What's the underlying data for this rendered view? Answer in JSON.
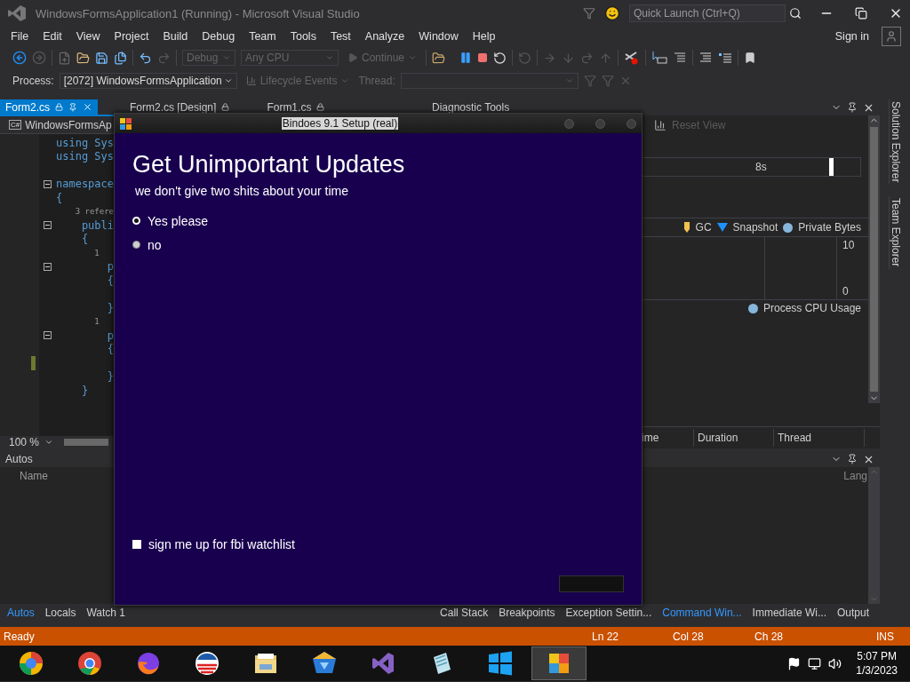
{
  "window": {
    "title": "WindowsFormsApplication1 (Running) - Microsoft Visual Studio"
  },
  "quick_launch": {
    "placeholder": "Quick Launch (Ctrl+Q)"
  },
  "menu": [
    "File",
    "Edit",
    "View",
    "Project",
    "Build",
    "Debug",
    "Team",
    "Tools",
    "Test",
    "Analyze",
    "Window",
    "Help"
  ],
  "account": {
    "label": "Sign in"
  },
  "toolbar": {
    "configuration": "Debug",
    "platform": "Any CPU",
    "continue": "Continue"
  },
  "debug_location": {
    "process_label": "Process:",
    "process": "[2072] WindowsFormsApplication",
    "lifecycle": "Lifecycle Events",
    "thread_label": "Thread:"
  },
  "editor": {
    "tabs": [
      {
        "label": "Form2.cs",
        "selected": true
      },
      {
        "label": "Form2.cs [Design]",
        "selected": false
      },
      {
        "label": "Form1.cs",
        "selected": false
      }
    ],
    "file_badge": "C#",
    "navigation": "WindowsFormsAp",
    "lines": [
      {
        "kind": "code",
        "text": "using Sys",
        "fold": false,
        "modified": false
      },
      {
        "kind": "code",
        "text": "using Sys",
        "fold": false,
        "modified": false
      },
      {
        "kind": "blank",
        "fold": false,
        "modified": false
      },
      {
        "kind": "code",
        "text": "namespace",
        "fold": true,
        "modified": false
      },
      {
        "kind": "code",
        "text": "{",
        "fold": false,
        "modified": false
      },
      {
        "kind": "lens",
        "text": "    3 refere",
        "fold": false,
        "modified": false
      },
      {
        "kind": "code",
        "text": "    publi",
        "fold": true,
        "modified": false
      },
      {
        "kind": "code",
        "text": "    {",
        "fold": false,
        "modified": false
      },
      {
        "kind": "lens",
        "text": "        1",
        "fold": false,
        "modified": false
      },
      {
        "kind": "code",
        "text": "        p",
        "fold": true,
        "modified": false
      },
      {
        "kind": "code",
        "text": "        {",
        "fold": false,
        "modified": false
      },
      {
        "kind": "blank",
        "fold": false,
        "modified": false
      },
      {
        "kind": "code",
        "text": "        }",
        "fold": false,
        "modified": false
      },
      {
        "kind": "lens",
        "text": "        1",
        "fold": false,
        "modified": false
      },
      {
        "kind": "code",
        "text": "        p",
        "fold": true,
        "modified": false
      },
      {
        "kind": "code",
        "text": "        {",
        "fold": false,
        "modified": false
      },
      {
        "kind": "blank",
        "fold": false,
        "modified": true
      },
      {
        "kind": "code",
        "text": "        }",
        "fold": false,
        "modified": false
      },
      {
        "kind": "code",
        "text": "    }",
        "fold": false,
        "modified": false
      }
    ],
    "zoom": "100 %"
  },
  "diagnostic_tools": {
    "title": "Diagnostic Tools",
    "reset_view": "Reset View",
    "ruler_label": "8s",
    "legend": [
      {
        "kind": "gc",
        "label": "GC"
      },
      {
        "kind": "snapshot",
        "label": "Snapshot"
      },
      {
        "kind": "series",
        "label": "Private Bytes"
      }
    ],
    "axis_max": "10",
    "axis_min": "0",
    "cpu_legend": "Process CPU Usage",
    "columns": [
      "ime",
      "Duration",
      "Thread"
    ]
  },
  "side_tabs": [
    "Solution Explorer",
    "Team Explorer"
  ],
  "autos": {
    "title": "Autos",
    "columns": [
      "Name"
    ]
  },
  "output_panel": {
    "columns": [
      "Lang"
    ]
  },
  "bottom_tabs_left": [
    {
      "label": "Autos",
      "selected": true
    },
    {
      "label": "Locals",
      "selected": false
    },
    {
      "label": "Watch 1",
      "selected": false
    }
  ],
  "bottom_tabs_right": [
    {
      "label": "Call Stack",
      "selected": false
    },
    {
      "label": "Breakpoints",
      "selected": false
    },
    {
      "label": "Exception Settin...",
      "selected": false
    },
    {
      "label": "Command Win...",
      "selected": true
    },
    {
      "label": "Immediate Wi...",
      "selected": false
    },
    {
      "label": "Output",
      "selected": false
    }
  ],
  "status_bar": {
    "state": "Ready",
    "line": "Ln 22",
    "column": "Col 28",
    "char": "Ch 28",
    "mode": "INS"
  },
  "taskbar": {
    "apps": [
      {
        "kind": "ball",
        "selected": false
      },
      {
        "kind": "chrome",
        "selected": false
      },
      {
        "kind": "fox",
        "selected": false
      },
      {
        "kind": "logo",
        "selected": false
      },
      {
        "kind": "folder",
        "selected": false
      },
      {
        "kind": "gem",
        "selected": false
      },
      {
        "kind": "infinity",
        "selected": false
      },
      {
        "kind": "notepad",
        "selected": false
      },
      {
        "kind": "windows",
        "selected": false
      },
      {
        "kind": "squares",
        "selected": true
      }
    ],
    "time": "5:07 PM",
    "date": "1/3/2023"
  },
  "dialog": {
    "title": "Bindoes 9.1 Setup (real)",
    "heading": "Get Unimportant Updates",
    "subtitle": "we don't give two shits about your time",
    "options": [
      {
        "label": "Yes please",
        "selected": true
      },
      {
        "label": "no",
        "selected": false
      }
    ],
    "checkbox": {
      "label": "sign me up for fbi watchlist",
      "checked": false
    }
  }
}
